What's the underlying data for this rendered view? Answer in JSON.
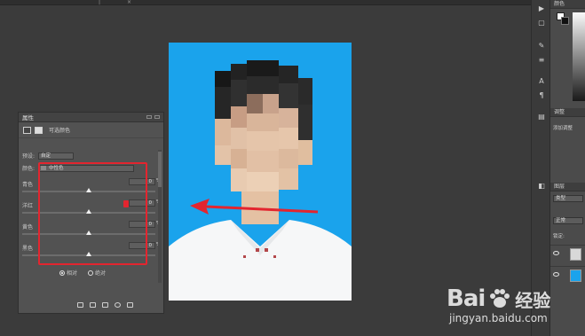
{
  "panel": {
    "title": "属性",
    "subtitle": "可选颜色",
    "preset_label": "预设:",
    "preset_value": "自定",
    "colors_label": "颜色:",
    "colors_value": "中性色",
    "sliders": [
      {
        "label": "青色",
        "value": "0",
        "unit": "%",
        "level": 0.5
      },
      {
        "label": "洋红",
        "value": "0",
        "unit": "%",
        "level": 0.5
      },
      {
        "label": "黄色",
        "value": "0",
        "unit": "%",
        "level": 0.5
      },
      {
        "label": "黑色",
        "value": "0",
        "unit": "%",
        "level": 0.5
      }
    ],
    "method_relative": "相对",
    "method_absolute": "绝对"
  },
  "right_panel": {
    "color_tab": "颜色",
    "adjust_tab": "调整",
    "add_adjust": "添加调整",
    "layers_tab": "图层",
    "kind_field": "类型",
    "blend_mode": "正常",
    "lock_label": "锁定:"
  },
  "watermark": {
    "brand": "Bai",
    "brand_cn": "经验",
    "url": "jingyan.baidu.com"
  },
  "colors": {
    "highlight_red": "#e3252f",
    "photo_blue": "#1aa3ec"
  }
}
